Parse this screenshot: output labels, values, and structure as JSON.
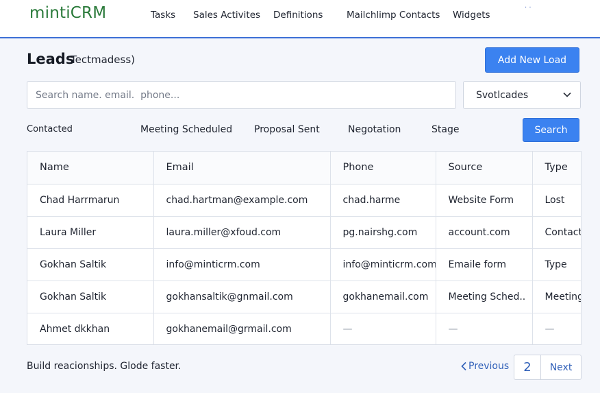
{
  "app": {
    "logo": "mintiCRM"
  },
  "nav": {
    "items": [
      {
        "label": "Tasks"
      },
      {
        "label": "Sales Activites"
      },
      {
        "label": "Definitions"
      },
      {
        "label": "Mailchlimp  Contacts"
      },
      {
        "label": "Widgets"
      }
    ],
    "dots": "·  ·"
  },
  "header": {
    "title": "Leads",
    "subtitle": "Tectmadess)",
    "add_button": "Add New Load"
  },
  "search": {
    "placeholder": "Search name. email.  phone...",
    "select_value": "Svotlcades"
  },
  "filters": {
    "items": [
      "Contacted",
      "Meeting Scheduled",
      "Proposal Sent",
      "Negotation",
      "Stage"
    ],
    "search_button": "Search"
  },
  "table": {
    "columns": [
      "Name",
      "Email",
      "Phone",
      "Source",
      "Type"
    ],
    "rows": [
      [
        "Chad Harrmarun",
        "chad.hartman@example.com",
        "chad.harme",
        "Website Form",
        "Lost"
      ],
      [
        "Laura Miller",
        "laura.miller@xfoud.com",
        "pg.nairshg.com",
        "account.com",
        "Contact."
      ],
      [
        "Gokhan Saltik",
        "info@minticrm.com",
        "info@minticrm.com",
        "Emaile form",
        "Type"
      ],
      [
        "Gokhan Saltik",
        "gokhansaltik@gnmail.com",
        "gokhanemail.com",
        "Meeting Sched..",
        "Meeting"
      ],
      [
        "Ahmet dkkhan",
        "gokhanemail@grmail.com",
        "—",
        "—",
        "—"
      ]
    ]
  },
  "footer": {
    "tagline": "Build reacionships.  Glode faster.",
    "previous": "Previous",
    "page": "2",
    "next": "Next"
  },
  "colors": {
    "accent": "#3b82f0",
    "logo": "#2a7a3a",
    "link": "#2f5fb8",
    "nav_border": "#3d6fd6"
  }
}
